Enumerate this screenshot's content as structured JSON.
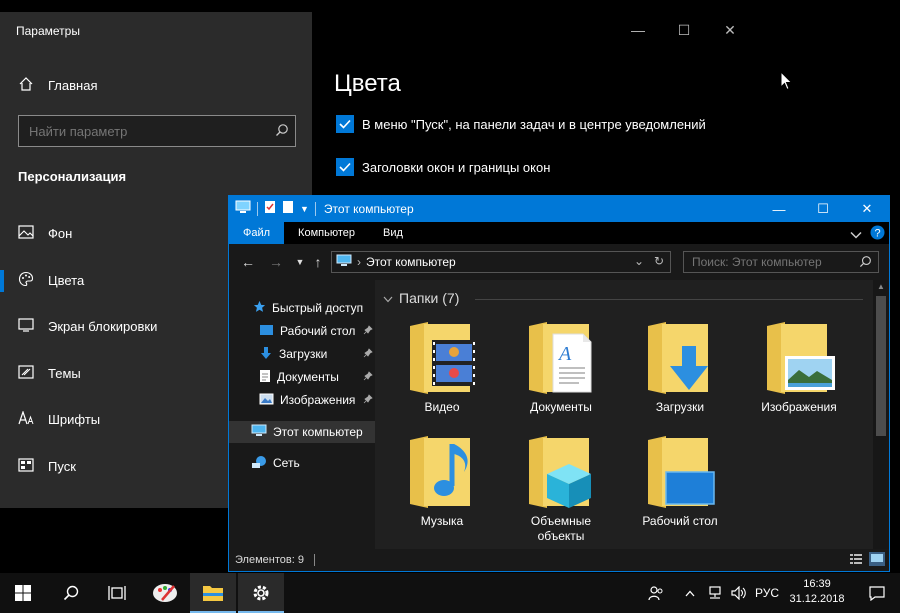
{
  "settings": {
    "window_title": "Параметры",
    "home_label": "Главная",
    "search_placeholder": "Найти параметр",
    "section_title": "Персонализация",
    "nav": [
      {
        "label": "Фон",
        "icon": "image-icon"
      },
      {
        "label": "Цвета",
        "icon": "palette-icon",
        "active": true
      },
      {
        "label": "Экран блокировки",
        "icon": "lock-screen-icon"
      },
      {
        "label": "Темы",
        "icon": "themes-icon"
      },
      {
        "label": "Шрифты",
        "icon": "fonts-icon"
      },
      {
        "label": "Пуск",
        "icon": "start-icon"
      }
    ],
    "page_heading": "Цвета",
    "checkboxes": [
      {
        "label": "В меню \"Пуск\", на панели задач и в центре уведомлений",
        "checked": true
      },
      {
        "label": "Заголовки окон и границы окон",
        "checked": true
      }
    ],
    "accent_color": "#0078d7"
  },
  "explorer": {
    "window_title": "Этот компьютер",
    "ribbon_tabs": [
      "Файл",
      "Компьютер",
      "Вид"
    ],
    "address": "Этот компьютер",
    "search_placeholder": "Поиск: Этот компьютер",
    "nav_pane": [
      {
        "label": "Быстрый доступ",
        "icon": "star-icon",
        "pinned": false
      },
      {
        "label": "Рабочий стол",
        "icon": "desktop-icon",
        "pinned": true
      },
      {
        "label": "Загрузки",
        "icon": "download-icon",
        "pinned": true
      },
      {
        "label": "Документы",
        "icon": "document-icon",
        "pinned": true
      },
      {
        "label": "Изображения",
        "icon": "pictures-icon",
        "pinned": true
      },
      {
        "label": "Этот компьютер",
        "icon": "computer-icon",
        "selected": true
      },
      {
        "label": "Сеть",
        "icon": "network-icon"
      }
    ],
    "group_title": "Папки (7)",
    "folders": [
      {
        "label": "Видео",
        "icon": "video-folder-icon"
      },
      {
        "label": "Документы",
        "icon": "documents-folder-icon"
      },
      {
        "label": "Загрузки",
        "icon": "downloads-folder-icon"
      },
      {
        "label": "Изображения",
        "icon": "pictures-folder-icon"
      },
      {
        "label": "Музыка",
        "icon": "music-folder-icon"
      },
      {
        "label": "Объемные объекты",
        "icon": "3d-objects-folder-icon"
      },
      {
        "label": "Рабочий стол",
        "icon": "desktop-folder-icon"
      }
    ],
    "status": "Элементов: 9"
  },
  "taskbar": {
    "language": "РУС",
    "time": "16:39",
    "date": "31.12.2018"
  }
}
